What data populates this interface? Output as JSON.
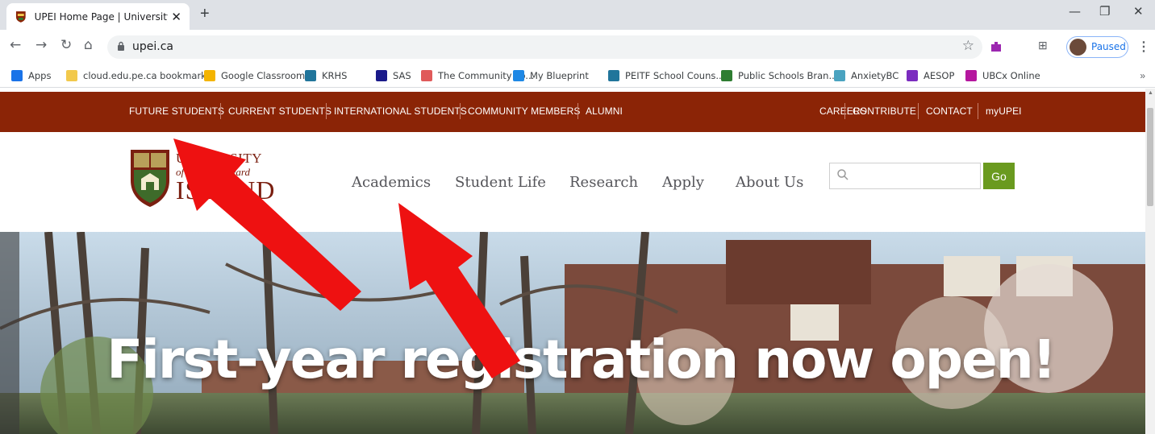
{
  "browser": {
    "tab_title": "UPEI Home Page | University of P",
    "url": "upei.ca",
    "profile_status": "Paused",
    "bookmarks": [
      {
        "label": "Apps",
        "icon": "apps-grid-icon",
        "color": "#1a73e8"
      },
      {
        "label": "cloud.edu.pe.ca bookmarks",
        "icon": "folder-icon",
        "color": "#f2c94c"
      },
      {
        "label": "Google Classroom",
        "icon": "classroom-icon",
        "color": "#f4b400"
      },
      {
        "label": "KRHS",
        "icon": "wordpress-icon",
        "color": "#21759b"
      },
      {
        "label": "SAS",
        "icon": "sas-icon",
        "color": "#1a1a8a"
      },
      {
        "label": "The Community Fo...",
        "icon": "tree-icon",
        "color": "#e05a5a"
      },
      {
        "label": "My Blueprint",
        "icon": "blueprint-icon",
        "color": "#1e88e5"
      },
      {
        "label": "PEITF School Couns...",
        "icon": "wordpress-icon",
        "color": "#21759b"
      },
      {
        "label": "Public Schools Bran...",
        "icon": "leaf-icon",
        "color": "#2e7d32"
      },
      {
        "label": "AnxietyBC",
        "icon": "anxietybc-icon",
        "color": "#4aa3c0"
      },
      {
        "label": "AESOP",
        "icon": "aesop-icon",
        "color": "#7b2cbf"
      },
      {
        "label": "UBCx Online",
        "icon": "edx-icon",
        "color": "#b5179e"
      }
    ]
  },
  "site": {
    "top_links_left": [
      "FUTURE STUDENTS",
      "CURRENT STUDENTS",
      "INTERNATIONAL STUDENTS",
      "COMMUNITY MEMBERS",
      "ALUMNI"
    ],
    "top_links_right": [
      "CAREERS",
      "CONTRIBUTE",
      "CONTACT",
      "myUPEI"
    ],
    "logo": {
      "line1": "UNIVERSITY",
      "line2": "of Prince Edward",
      "line3": "ISLAND"
    },
    "main_nav": [
      "Academics",
      "Student Life",
      "Research",
      "Apply",
      "About Us"
    ],
    "search": {
      "placeholder": "",
      "value": ""
    },
    "go_label": "Go",
    "hero_headline": "First-year registration now open!"
  },
  "colors": {
    "topnav_bg": "#8b2406",
    "go_button": "#6a9a1f",
    "annotation_arrows": "#ee1111"
  }
}
